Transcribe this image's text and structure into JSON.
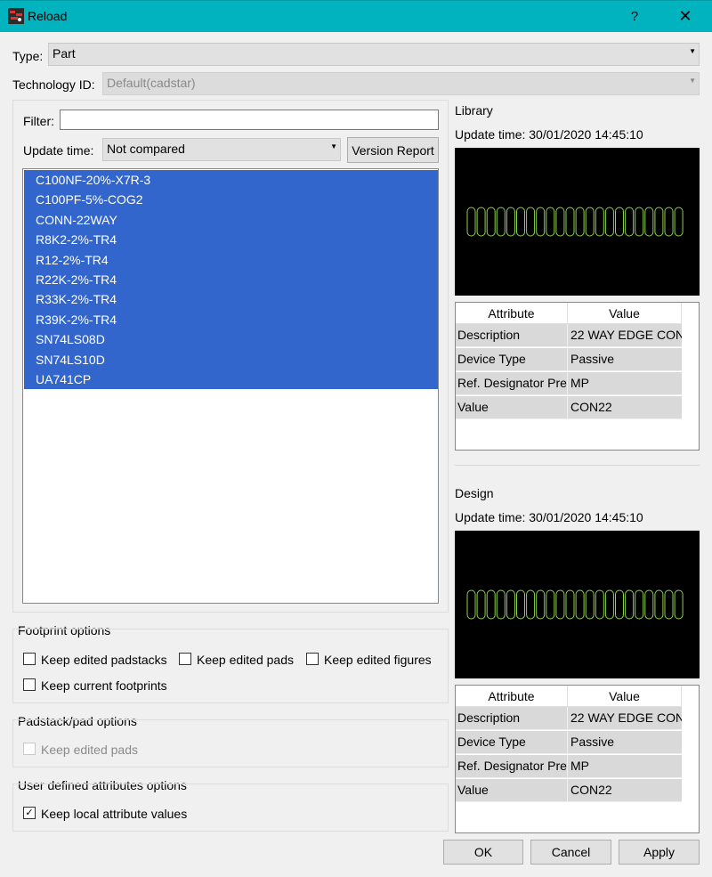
{
  "window": {
    "title": "Reload",
    "help_glyph": "?",
    "close_glyph": "✕"
  },
  "top": {
    "type_label": "Type:",
    "type_value": "Part",
    "tech_label": "Technology ID:",
    "tech_value": "Default(cadstar)"
  },
  "filter": {
    "filter_label": "Filter:",
    "filter_value": "",
    "update_time_label": "Update time:",
    "update_time_value": "Not compared",
    "version_report_label": "Version Report"
  },
  "parts": [
    "C100NF-20%-X7R-3",
    "C100PF-5%-COG2",
    "CONN-22WAY",
    "R8K2-2%-TR4",
    "R12-2%-TR4",
    "R22K-2%-TR4",
    "R33K-2%-TR4",
    "R39K-2%-TR4",
    "SN74LS08D",
    "SN74LS10D",
    "UA741CP"
  ],
  "footprint": {
    "group_label": "Footprint options",
    "keep_padstacks": "Keep edited padstacks",
    "keep_pads": "Keep edited pads",
    "keep_figures": "Keep edited figures",
    "keep_footprints": "Keep current footprints"
  },
  "padstack": {
    "group_label": "Padstack/pad options",
    "keep_pads": "Keep edited pads"
  },
  "user_attrs": {
    "group_label": "User defined attributes options",
    "keep_local": "Keep local attribute values",
    "check_glyph": "✓"
  },
  "library": {
    "heading": "Library",
    "update_time": "Update time: 30/01/2020 14:45:10",
    "col_attribute": "Attribute",
    "col_value": "Value",
    "rows": [
      {
        "attr": "Description",
        "value": "22 WAY EDGE CON"
      },
      {
        "attr": "Device Type",
        "value": "Passive"
      },
      {
        "attr": "Ref. Designator Pre",
        "value": "MP"
      },
      {
        "attr": "Value",
        "value": "CON22"
      }
    ]
  },
  "design": {
    "heading": "Design",
    "update_time": "Update time: 30/01/2020 14:45:10",
    "col_attribute": "Attribute",
    "col_value": "Value",
    "rows": [
      {
        "attr": "Description",
        "value": "22 WAY EDGE CON"
      },
      {
        "attr": "Device Type",
        "value": "Passive"
      },
      {
        "attr": "Ref. Designator Pre",
        "value": "MP"
      },
      {
        "attr": "Value",
        "value": "CON22"
      }
    ]
  },
  "buttons": {
    "ok": "OK",
    "cancel": "Cancel",
    "apply": "Apply"
  },
  "colors": {
    "titlebar": "#00b3bf",
    "selection": "#3266cc",
    "pad_outline": "#8fd14f"
  }
}
